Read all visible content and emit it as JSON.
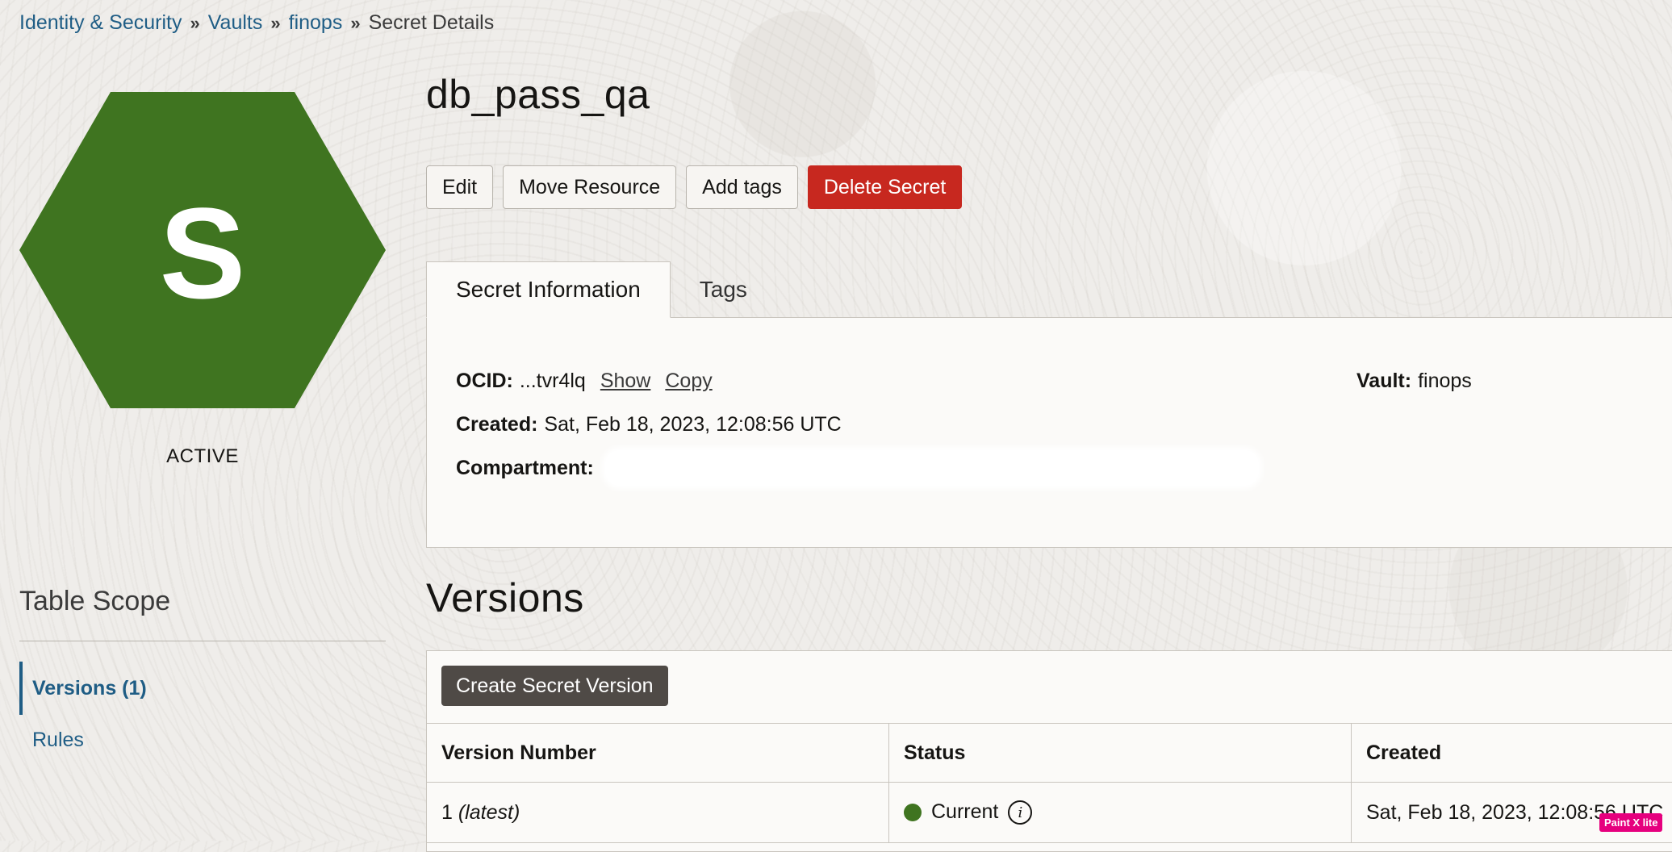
{
  "breadcrumb": {
    "items": [
      "Identity & Security",
      "Vaults",
      "finops"
    ],
    "current": "Secret Details",
    "separator": "»"
  },
  "resource": {
    "icon_letter": "S",
    "icon_color": "#3f7420",
    "state": "ACTIVE",
    "name": "db_pass_qa"
  },
  "actions": {
    "edit": "Edit",
    "move": "Move Resource",
    "add_tags": "Add tags",
    "delete": "Delete Secret"
  },
  "tabs": {
    "secret_info": "Secret Information",
    "tags": "Tags"
  },
  "info": {
    "ocid_label": "OCID:",
    "ocid_value": "...tvr4lq",
    "show": "Show",
    "copy": "Copy",
    "vault_label": "Vault:",
    "vault_value": "finops",
    "created_label": "Created:",
    "created_value": "Sat, Feb 18, 2023, 12:08:56 UTC",
    "compartment_label": "Compartment:"
  },
  "scope": {
    "title": "Table Scope",
    "items": [
      "Versions (1)",
      "Rules"
    ]
  },
  "versions": {
    "heading": "Versions",
    "create_button": "Create Secret Version",
    "columns": [
      "Version Number",
      "Status",
      "Created"
    ],
    "rows": [
      {
        "number": "1",
        "latest": "(latest)",
        "status": "Current",
        "created": "Sat, Feb 18, 2023, 12:08:56 UTC"
      }
    ]
  },
  "watermark": "Paint X lite"
}
